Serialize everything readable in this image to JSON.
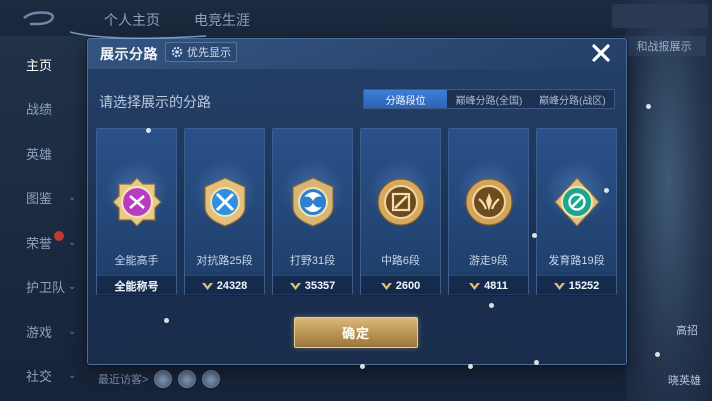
{
  "background": {
    "top_tabs": [
      "个人主页",
      "电竞生涯"
    ],
    "sidebar": [
      {
        "label": "主页",
        "active": true,
        "chevron": false,
        "new": false
      },
      {
        "label": "战绩",
        "active": false,
        "chevron": false,
        "new": false
      },
      {
        "label": "英雄",
        "active": false,
        "chevron": false,
        "new": false
      },
      {
        "label": "图鉴",
        "active": false,
        "chevron": true,
        "new": false
      },
      {
        "label": "荣誉",
        "active": false,
        "chevron": true,
        "new": true
      },
      {
        "label": "护卫队",
        "active": false,
        "chevron": true,
        "new": false
      },
      {
        "label": "游戏",
        "active": false,
        "chevron": true,
        "new": false
      },
      {
        "label": "社交",
        "active": false,
        "chevron": true,
        "new": false
      }
    ],
    "right_button": "和战报展示",
    "right_labels": [
      "高招",
      "晓英雄"
    ],
    "recent_visitors": "最近访客>"
  },
  "dialog": {
    "title": "展示分路",
    "priority_label": "优先显示",
    "subtitle": "请选择展示的分路",
    "tabs": [
      {
        "label": "分路段位",
        "active": true
      },
      {
        "label": "巅峰分路(全国)",
        "active": false
      },
      {
        "label": "巅峰分路(战区)",
        "active": false
      }
    ],
    "cards": [
      {
        "icon": "all-round-emblem-icon",
        "name": "全能高手",
        "stat": "全能称号",
        "has_icon": false
      },
      {
        "icon": "clash-lane-emblem-icon",
        "name": "对抗路25段",
        "stat": "24328",
        "has_icon": true
      },
      {
        "icon": "jungle-emblem-icon",
        "name": "打野31段",
        "stat": "35357",
        "has_icon": true
      },
      {
        "icon": "mid-lane-emblem-icon",
        "name": "中路6段",
        "stat": "2600",
        "has_icon": true
      },
      {
        "icon": "roam-emblem-icon",
        "name": "游走9段",
        "stat": "4811",
        "has_icon": true
      },
      {
        "icon": "farm-lane-emblem-icon",
        "name": "发育路19段",
        "stat": "15252",
        "has_icon": true
      }
    ],
    "confirm_label": "确定"
  },
  "colors": {
    "active_tab": "#3a78cf",
    "confirm_gold": "#c9a564",
    "panel": "#1e3a63"
  }
}
